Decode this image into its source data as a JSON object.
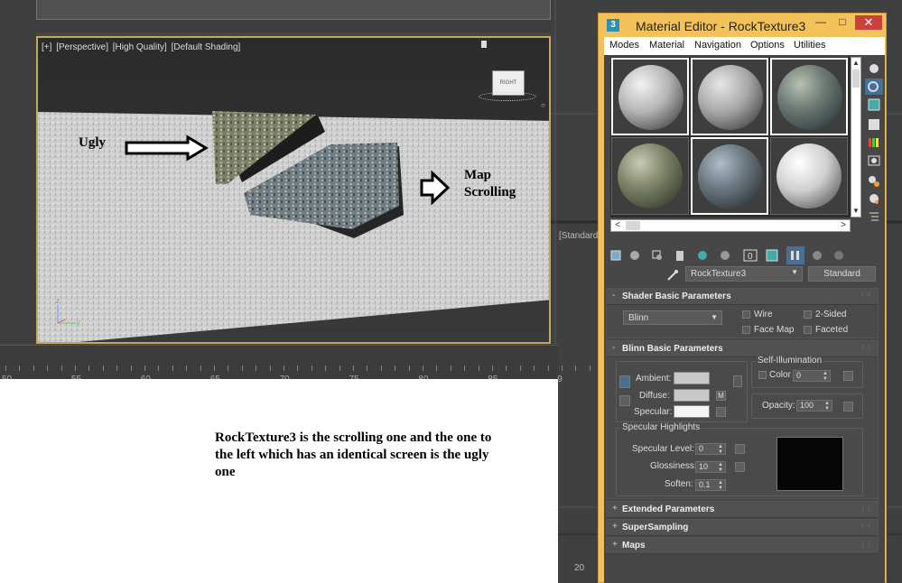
{
  "viewport": {
    "label_parts": [
      "[+]",
      "[Perspective]",
      "[High Quality]",
      "[Default Shading]"
    ],
    "viewcube_label": "RIGHT",
    "annotation_ugly": "Ugly",
    "annotation_map_line1": "Map",
    "annotation_map_line2": "Scrolling"
  },
  "ruler": {
    "labels": [
      "50",
      "55",
      "60",
      "65",
      "70",
      "75",
      "80",
      "85",
      "9"
    ]
  },
  "note": "RockTexture3 is the scrolling one and the one to the left which has an identical screen is the ugly one",
  "right_panel": {
    "standard_label": "[Standard",
    "timeline_number": "20"
  },
  "material_editor": {
    "title": "Material Editor - RockTexture3",
    "app_icon_text": "3",
    "window_buttons": {
      "minimize": "—",
      "maximize": "□",
      "close": "✕"
    },
    "menu": [
      "Modes",
      "Material",
      "Navigation",
      "Options",
      "Utilities"
    ],
    "slots": [
      {
        "name": "slot-1",
        "style": "gray1",
        "selected": true
      },
      {
        "name": "slot-2",
        "style": "gray2",
        "selected": true
      },
      {
        "name": "slot-3",
        "style": "rock1",
        "selected": true
      },
      {
        "name": "slot-4",
        "style": "rock2",
        "selected": false
      },
      {
        "name": "slot-5",
        "style": "rock3",
        "selected": true
      },
      {
        "name": "slot-6",
        "style": "gray3",
        "selected": false
      }
    ],
    "material_name": "RockTexture3",
    "material_type": "Standard",
    "shader_basic": {
      "title": "Shader Basic Parameters",
      "shader": "Blinn",
      "wire": "Wire",
      "two_sided": "2-Sided",
      "face_map": "Face Map",
      "faceted": "Faceted"
    },
    "blinn_basic": {
      "title": "Blinn Basic Parameters",
      "ambient": "Ambient:",
      "diffuse": "Diffuse:",
      "specular": "Specular:",
      "map_letter": "M",
      "self_illum_title": "Self-Illumination",
      "color_label": "Color",
      "color_value": "0",
      "opacity_label": "Opacity:",
      "opacity_value": "100",
      "spec_highlights_title": "Specular Highlights",
      "spec_level_label": "Specular Level:",
      "spec_level_value": "0",
      "glossiness_label": "Glossiness:",
      "glossiness_value": "10",
      "soften_label": "Soften:",
      "soften_value": "0.1"
    },
    "collapsed_rollouts": [
      "Extended Parameters",
      "SuperSampling",
      "Maps"
    ],
    "colors": {
      "ambient": "#c8c8c8",
      "diffuse": "#c8c8c8",
      "specular": "#f5f5f5",
      "title_bar": "#f4c25a"
    }
  }
}
